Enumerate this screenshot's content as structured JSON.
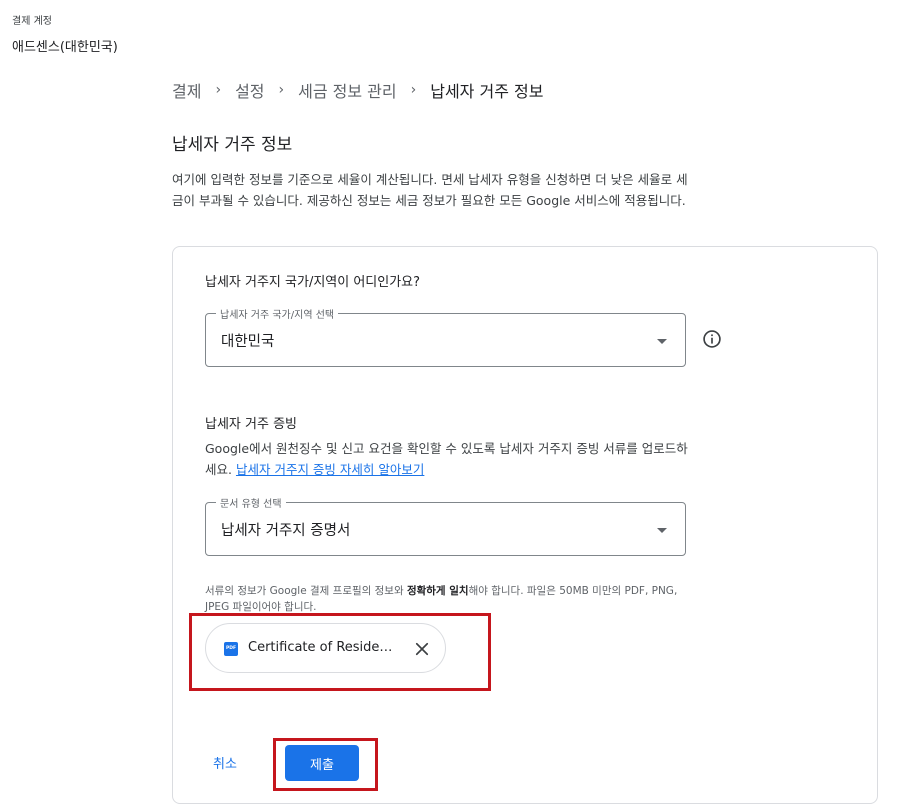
{
  "account": {
    "label": "결제 계정",
    "name": "애드센스(대한민국)"
  },
  "breadcrumb": {
    "items": [
      "결제",
      "설정",
      "세금 정보 관리"
    ],
    "current": "납세자 거주 정보",
    "separator": "›"
  },
  "page": {
    "title": "납세자 거주 정보",
    "description": "여기에 입력한 정보를 기준으로 세율이 계산됩니다. 면세 납세자 유형을 신청하면 더 낮은 세율로 세금이 부과될 수 있습니다. 제공하신 정보는 세금 정보가 필요한 모든 Google 서비스에 적용됩니다."
  },
  "residency": {
    "question": "납세자 거주지 국가/지역이 어디인가요?",
    "select_label": "납세자 거주 국가/지역 선택",
    "select_value": "대한민국",
    "info_icon": "info-icon"
  },
  "proof": {
    "title": "납세자 거주 증빙",
    "description": "Google에서 원천징수 및 신고 요건을 확인할 수 있도록 납세자 거주지 증빙 서류를 업로드하세요.",
    "link_text": "납세자 거주지 증빙 자세히 알아보기",
    "doc_select_label": "문서 유형 선택",
    "doc_select_value": "납세자 거주지 증명서",
    "file_note_prefix": "서류의 정보가 Google 결제 프로필의 정보와 ",
    "file_note_bold": "정확하게 일치",
    "file_note_suffix": "해야 합니다. 파일은 50MB 미만의 PDF, PNG, JPEG 파일이어야 합니다."
  },
  "file": {
    "icon_text": "PDF",
    "name": "Certificate of Residence"
  },
  "actions": {
    "cancel_label": "취소",
    "submit_label": "제출"
  },
  "colors": {
    "accent": "#1a73e8",
    "highlight": "#c5161d",
    "border": "#dadce0"
  }
}
